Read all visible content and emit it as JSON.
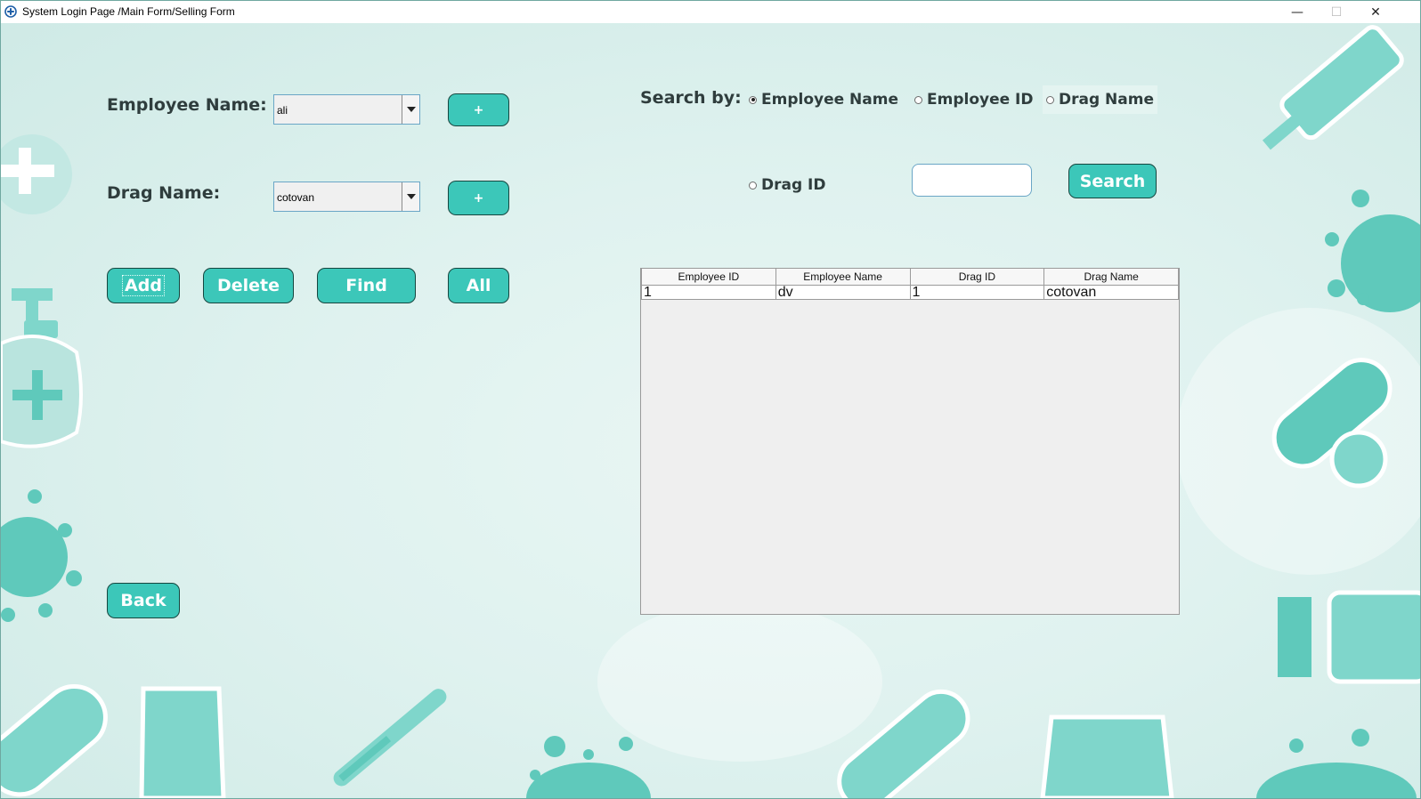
{
  "window": {
    "title": "System Login Page /Main Form/Selling Form",
    "controls": {
      "minimize": "—",
      "maximize": "☐",
      "close": "✕"
    }
  },
  "form": {
    "employee_label": "Employee Name:",
    "employee_value": "ali",
    "drag_label": "Drag Name:",
    "drag_value": "cotovan",
    "add_employee_btn": "+",
    "add_drag_btn": "+",
    "buttons": {
      "add": "Add",
      "delete": "Delete",
      "find": "Find",
      "all": "All",
      "back": "Back"
    }
  },
  "search": {
    "label": "Search by:",
    "options": [
      {
        "label": "Employee Name",
        "selected": true
      },
      {
        "label": "Employee ID",
        "selected": false
      },
      {
        "label": "Drag Name",
        "selected": false
      },
      {
        "label": "Drag ID",
        "selected": false
      }
    ],
    "input_value": "",
    "button": "Search"
  },
  "table": {
    "columns": [
      "Employee ID",
      "Employee Name",
      "Drag ID",
      "Drag Name"
    ],
    "rows": [
      [
        "1",
        "dv",
        "1",
        "cotovan"
      ]
    ]
  },
  "colors": {
    "accent": "#3cc7b9",
    "accent_border": "#16463f",
    "background": "#dff2ef",
    "art": "#7fd6cb"
  }
}
